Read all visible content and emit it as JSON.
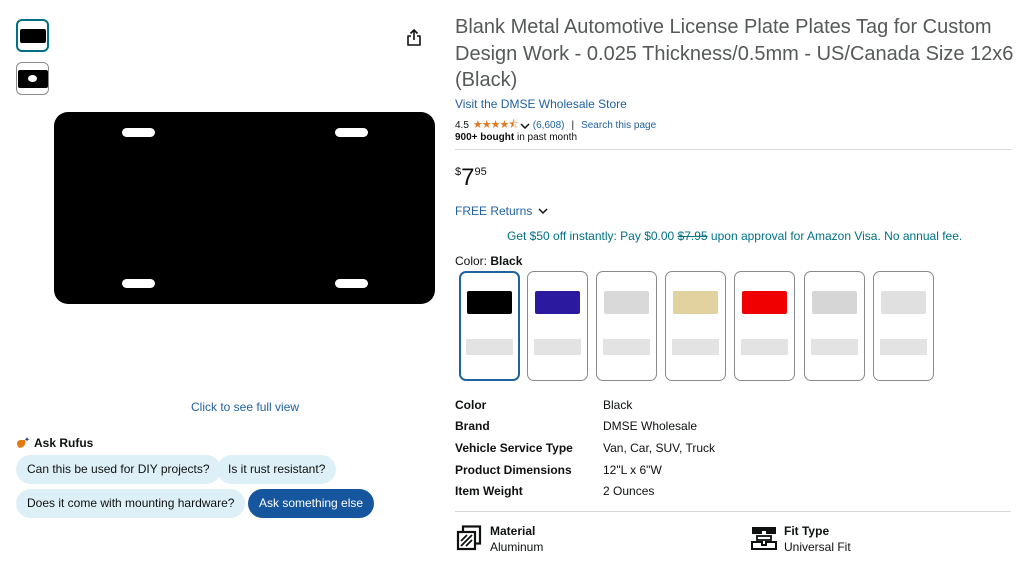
{
  "product": {
    "title": "Blank Metal Automotive License Plate Plates Tag for Custom Design Work - 0.025 Thickness/0.5mm - US/Canada Size 12x6 (Black)",
    "store_link": "Visit the DMSE Wholesale Store",
    "rating": "4.5",
    "stars": "★★★★⯪",
    "rating_count": "(6,608)",
    "rating_sep": "|",
    "search_page": "Search this page",
    "bought_bold": "900+ bought",
    "bought_rest": " in past month"
  },
  "gallery": {
    "full_view": "Click to see full view"
  },
  "rufus": {
    "label": "Ask Rufus",
    "chips": [
      "Can this be used for DIY projects?",
      "Is it rust resistant?",
      "Does it come with mounting hardware?",
      "Ask something else"
    ]
  },
  "price": {
    "symbol": "$",
    "whole": "7",
    "fraction": "95"
  },
  "returns": {
    "label": "FREE Returns"
  },
  "promo": {
    "prefix": "Get $50 off instantly: Pay $0.00 ",
    "strike": "$7.95",
    "suffix": " upon approval for Amazon Visa. No annual fee."
  },
  "color": {
    "label": "Color: ",
    "selected": "Black",
    "swatches": [
      {
        "color": "#000000",
        "selected": true
      },
      {
        "color": "#2b1aa0",
        "selected": false
      },
      {
        "color": "#d9d9d9",
        "selected": false
      },
      {
        "color": "#e2d2a0",
        "selected": false
      },
      {
        "color": "#f00000",
        "selected": false
      },
      {
        "color": "#d6d6d6",
        "selected": false
      },
      {
        "color": "#e0e0e0",
        "selected": false
      }
    ]
  },
  "specs": [
    {
      "key": "Color",
      "value": "Black"
    },
    {
      "key": "Brand",
      "value": "DMSE Wholesale"
    },
    {
      "key": "Vehicle Service Type",
      "value": "Van, Car, SUV, Truck"
    },
    {
      "key": "Product Dimensions",
      "value": "12\"L x 6\"W"
    },
    {
      "key": "Item Weight",
      "value": "2 Ounces"
    }
  ],
  "features": [
    {
      "key": "Material",
      "value": "Aluminum",
      "icon": "material-icon"
    },
    {
      "key": "Fit Type",
      "value": "Universal Fit",
      "icon": "fit-type-icon"
    }
  ]
}
